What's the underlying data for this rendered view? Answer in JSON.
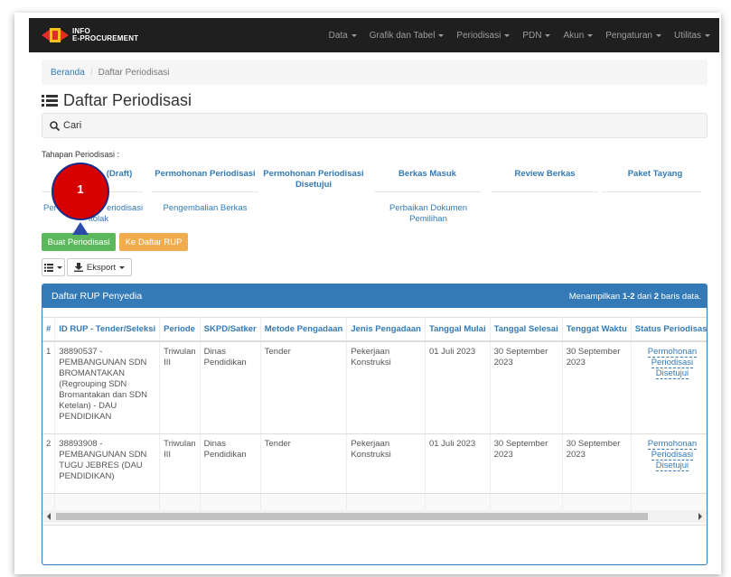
{
  "brand": {
    "line1": "INFO",
    "line2": "E-PROCUREMENT"
  },
  "nav": [
    "Data",
    "Grafik dan Tabel",
    "Periodisasi",
    "PDN",
    "Akun",
    "Pengaturan",
    "Utilitas"
  ],
  "breadcrumb": {
    "home": "Beranda",
    "separator": "/",
    "current": "Daftar Periodisasi"
  },
  "page_title": "Daftar Periodisasi",
  "search_label": "Cari",
  "tahapan_label": "Tahapan Periodisasi :",
  "stages": {
    "draft": "(Draft)",
    "permohonan": "Permohonan Periodisasi",
    "disetujui": "Permohonan Periodisasi Disetujui",
    "berkas_masuk": "Berkas Masuk",
    "review": "Review Berkas",
    "paket_tayang": "Paket Tayang",
    "ditolak_a": "Per",
    "ditolak_b": "eriodisasi",
    "ditolak_c": "itolak",
    "pengembalian": "Pengembalian Berkas",
    "perbaikan": "Perbaikan Dokumen Pemilihan"
  },
  "buttons": {
    "buat": "Buat Periodisasi",
    "rup": "Ke Daftar RUP",
    "eksport": "Eksport"
  },
  "annotation": "1",
  "panel": {
    "title": "Daftar RUP Penyedia",
    "info_prefix": "Menampilkan ",
    "info_range": "1-2",
    "info_mid": " dari ",
    "info_total": "2",
    "info_suffix": " baris data."
  },
  "table": {
    "headers": [
      "#",
      "ID RUP - Tender/Seleksi",
      "Periode",
      "SKPD/Satker",
      "Metode Pengadaan",
      "Jenis Pengadaan",
      "Tanggal Mulai",
      "Tanggal Selesai",
      "Tenggat Waktu",
      "Status Periodisasi"
    ],
    "rows": [
      [
        "1",
        "38890537 - PEMBANGUNAN SDN BROMANTAKAN (Regrouping SDN Bromantakan dan SDN Ketelan) - DAU PENDIDIKAN",
        "Triwulan III",
        "Dinas Pendidikan",
        "Tender",
        "Pekerjaan Konstruksi",
        "01 Juli 2023",
        "30 September 2023",
        "30 September 2023",
        "Permohonan Periodisasi Disetujui"
      ],
      [
        "2",
        "38893908 - PEMBANGUNAN SDN TUGU JEBRES (DAU PENDIDIKAN)",
        "Triwulan III",
        "Dinas Pendidikan",
        "Tender",
        "Pekerjaan Konstruksi",
        "01 Juli 2023",
        "30 September 2023",
        "30 September 2023",
        "Permohonan Periodisasi Disetujui"
      ]
    ]
  }
}
